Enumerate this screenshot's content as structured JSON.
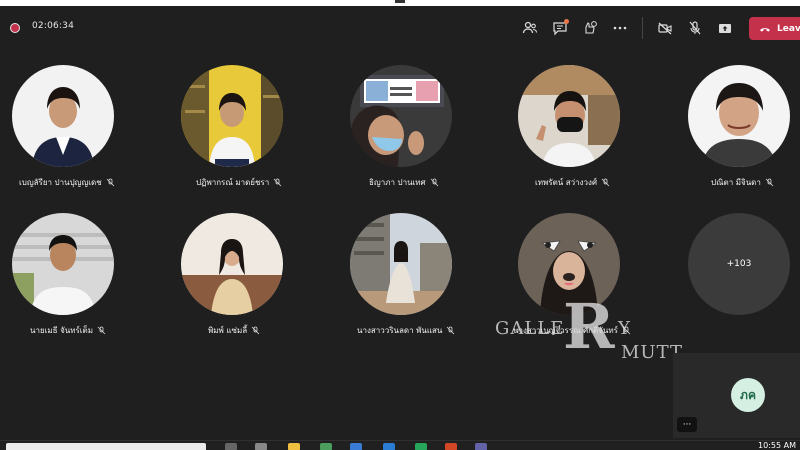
{
  "meeting": {
    "timer": "02:06:34",
    "leave_label": "Leave",
    "accent": "#c4314b"
  },
  "toolbar_icons": [
    "people-icon",
    "chat-icon",
    "reactions-icon",
    "more-icon",
    "camera-off-icon",
    "mic-off-icon",
    "share-icon",
    "phone-icon"
  ],
  "participants": [
    {
      "name": "เบญลัรียา ปานปุญญเดช",
      "muted": true
    },
    {
      "name": "ปฏิพากรณ์ มาดย์ชรา",
      "muted": true
    },
    {
      "name": "ธิญาภา ปานเทศ",
      "muted": true
    },
    {
      "name": "เทพรัตน์ สว่างวงศ์",
      "muted": true
    },
    {
      "name": "ปณิตา มีจินดา",
      "muted": true
    },
    {
      "name": "นายเมธี จันทร์เต็ม",
      "muted": true
    },
    {
      "name": "พิมพ์ แซ่มลี้",
      "muted": true
    },
    {
      "name": "นางสาววรินลดา พันแสน",
      "muted": true
    },
    {
      "name": "นางสาวเบญจวรรณ ศักดิ์จันทร์",
      "muted": true
    }
  ],
  "overflow": {
    "label": "+103"
  },
  "watermark": {
    "left": "GALLE",
    "mid": "R",
    "right": "Y",
    "bottom": "MUTT"
  },
  "self": {
    "initials": "ภค"
  },
  "more_label": "···",
  "taskbar": {
    "clock": "10:55 AM"
  }
}
